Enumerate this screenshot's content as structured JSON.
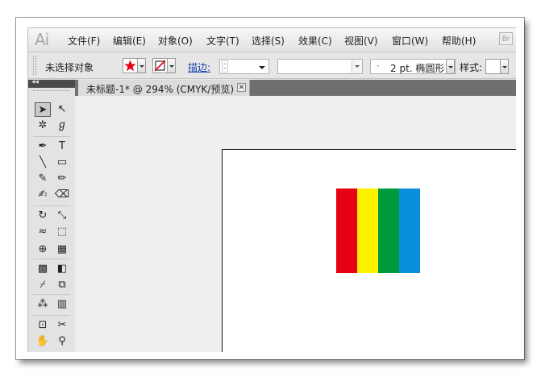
{
  "app": {
    "logo": "Ai"
  },
  "menu": [
    {
      "key": "file",
      "label": "文件(F)"
    },
    {
      "key": "edit",
      "label": "编辑(E)"
    },
    {
      "key": "object",
      "label": "对象(O)"
    },
    {
      "key": "type",
      "label": "文字(T)"
    },
    {
      "key": "select",
      "label": "选择(S)"
    },
    {
      "key": "effect",
      "label": "效果(C)"
    },
    {
      "key": "view",
      "label": "视图(V)"
    },
    {
      "key": "window",
      "label": "窗口(W)"
    },
    {
      "key": "help",
      "label": "帮助(H)"
    }
  ],
  "window_button": "Br",
  "control": {
    "selection_status": "未选择对象",
    "fill_color": "#e60012",
    "stroke_label": "描边:",
    "stroke_weight": "",
    "brush_dot": "·",
    "brush_label": "2 pt. 椭圆形",
    "style_label": "样式:"
  },
  "tools": {
    "collapse": "◂◂",
    "items": [
      {
        "name": "selection-tool-icon",
        "glyph": "➤",
        "selected": true
      },
      {
        "name": "direct-selection-tool-icon",
        "glyph": "↖",
        "selected": false
      },
      {
        "name": "magic-wand-tool-icon",
        "glyph": "✲",
        "selected": false
      },
      {
        "name": "lasso-tool-icon",
        "glyph": "ℊ",
        "selected": false
      },
      {
        "name": "pen-tool-icon",
        "glyph": "✒",
        "selected": false
      },
      {
        "name": "type-tool-icon",
        "glyph": "T",
        "selected": false
      },
      {
        "name": "line-segment-tool-icon",
        "glyph": "╲",
        "selected": false
      },
      {
        "name": "rectangle-tool-icon",
        "glyph": "▭",
        "selected": false
      },
      {
        "name": "paintbrush-tool-icon",
        "glyph": "✎",
        "selected": false
      },
      {
        "name": "pencil-tool-icon",
        "glyph": "✏",
        "selected": false
      },
      {
        "name": "blob-brush-tool-icon",
        "glyph": "✍",
        "selected": false
      },
      {
        "name": "eraser-tool-icon",
        "glyph": "⌫",
        "selected": false
      },
      {
        "name": "rotate-tool-icon",
        "glyph": "↻",
        "selected": false
      },
      {
        "name": "scale-tool-icon",
        "glyph": "⤡",
        "selected": false
      },
      {
        "name": "warp-tool-icon",
        "glyph": "≈",
        "selected": false
      },
      {
        "name": "free-transform-tool-icon",
        "glyph": "⬚",
        "selected": false
      },
      {
        "name": "shape-builder-tool-icon",
        "glyph": "⊕",
        "selected": false
      },
      {
        "name": "perspective-grid-tool-icon",
        "glyph": "▦",
        "selected": false
      },
      {
        "name": "mesh-tool-icon",
        "glyph": "▩",
        "selected": false
      },
      {
        "name": "gradient-tool-icon",
        "glyph": "◧",
        "selected": false
      },
      {
        "name": "eyedropper-tool-icon",
        "glyph": "⌿",
        "selected": false
      },
      {
        "name": "blend-tool-icon",
        "glyph": "⧉",
        "selected": false
      },
      {
        "name": "symbol-sprayer-tool-icon",
        "glyph": "⁂",
        "selected": false
      },
      {
        "name": "column-graph-tool-icon",
        "glyph": "▥",
        "selected": false
      },
      {
        "name": "artboard-tool-icon",
        "glyph": "⊡",
        "selected": false
      },
      {
        "name": "slice-tool-icon",
        "glyph": "✂",
        "selected": false
      },
      {
        "name": "hand-tool-icon",
        "glyph": "✋",
        "selected": false
      },
      {
        "name": "zoom-tool-icon",
        "glyph": "⚲",
        "selected": false
      }
    ]
  },
  "document": {
    "tab_label": "未标题-1* @ 294% (CMYK/预览)",
    "close_glyph": "✕"
  },
  "artwork": {
    "stripes": [
      "#e60012",
      "#fff200",
      "#009a3e",
      "#0a8fdc"
    ]
  }
}
